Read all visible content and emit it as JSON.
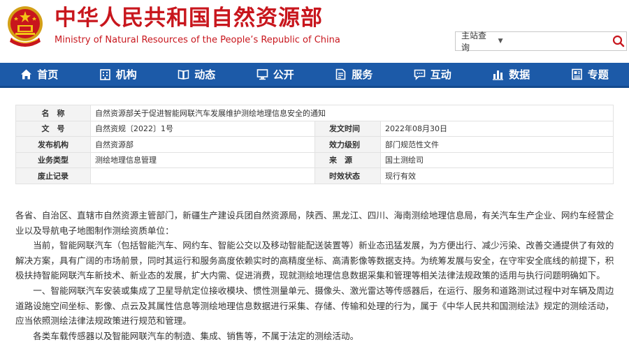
{
  "header": {
    "title_cn": "中华人民共和国自然资源部",
    "title_en": "Ministry of Natural Resources of the People’s Republic of China"
  },
  "search": {
    "scope": "主站查询",
    "placeholder": ""
  },
  "nav": [
    {
      "label": "首页",
      "icon": "home-icon"
    },
    {
      "label": "机构",
      "icon": "building-icon"
    },
    {
      "label": "动态",
      "icon": "book-icon"
    },
    {
      "label": "公开",
      "icon": "monitor-icon"
    },
    {
      "label": "服务",
      "icon": "document-edit-icon"
    },
    {
      "label": "互动",
      "icon": "chat-icon"
    },
    {
      "label": "数据",
      "icon": "bar-chart-icon"
    },
    {
      "label": "专题",
      "icon": "topic-icon"
    }
  ],
  "meta": {
    "name_label": "名　称",
    "name_value": "自然资源部关于促进智能网联汽车发展维护测绘地理信息安全的通知",
    "doc_no_label": "文　号",
    "doc_no_value": "自然资规〔2022〕1号",
    "issue_date_label": "发文时间",
    "issue_date_value": "2022年08月30日",
    "issuer_label": "发布机构",
    "issuer_value": "自然资源部",
    "level_label": "效力级别",
    "level_value": "部门规范性文件",
    "category_label": "业务类型",
    "category_value": "测绘地理信息管理",
    "source_label": "来　源",
    "source_value": "国土测绘司",
    "repeal_label": "废止记录",
    "repeal_value": "",
    "status_label": "时效状态",
    "status_value": "现行有效"
  },
  "body": {
    "p1": "各省、自治区、直辖市自然资源主管部门，新疆生产建设兵团自然资源局，陕西、黑龙江、四川、海南测绘地理信息局，有关汽车生产企业、网约车经营企业以及导航电子地图制作测绘资质单位：",
    "p2": "当前，智能网联汽车（包括智能汽车、网约车、智能公交以及移动智能配送装置等）新业态迅猛发展，为方便出行、减少污染、改善交通提供了有效的解决方案，具有广阔的市场前景，同时其运行和服务高度依赖实时的高精度坐标、高清影像等数据支持。为统筹发展与安全，在守牢安全底线的前提下，积极扶持智能网联汽车新技术、新业态的发展，扩大内需、促进消费，现就测绘地理信息数据采集和管理等相关法律法规政策的适用与执行问题明确如下。",
    "p3": "一、智能网联汽车安装或集成了卫星导航定位接收模块、惯性测量单元、摄像头、激光雷达等传感器后，在运行、服务和道路测试过程中对车辆及周边道路设施空间坐标、影像、点云及其属性信息等测绘地理信息数据进行采集、存储、传输和处理的行为，属于《中华人民共和国测绘法》规定的测绘活动，应当依照测绘法律法规政策进行规范和管理。",
    "p4": "各类车载传感器以及智能网联汽车的制造、集成、销售等，不属于法定的测绘活动。"
  },
  "colors": {
    "brand_red": "#c8161d",
    "nav_blue": "#1c5aa8"
  }
}
